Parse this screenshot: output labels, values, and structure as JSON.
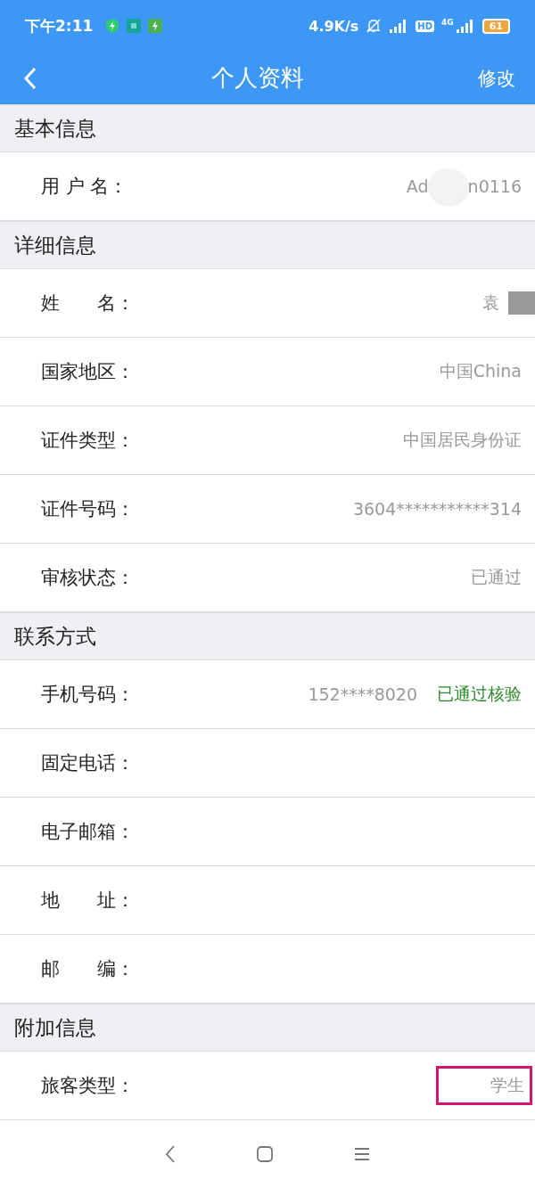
{
  "status_bar": {
    "time": "下午2:11",
    "speed": "4.9K/s",
    "hd": "HD",
    "network": "4G",
    "battery": "61"
  },
  "nav": {
    "title": "个人资料",
    "action": "修改"
  },
  "sections": [
    {
      "title": "基本信息",
      "rows": [
        {
          "label": "用 户 名：",
          "value_parts": [
            "Ad",
            "n0116"
          ],
          "redacted": true
        }
      ]
    },
    {
      "title": "详细信息",
      "rows": [
        {
          "label": "姓　　名：",
          "value_parts": [
            "袁"
          ],
          "redacted": true
        },
        {
          "label": "国家地区：",
          "value_parts": [
            "中国China"
          ]
        },
        {
          "label": "证件类型：",
          "value_parts": [
            "中国居民身份证"
          ]
        },
        {
          "label": "证件号码：",
          "value_parts": [
            "3604***********314"
          ]
        },
        {
          "label": "审核状态：",
          "value_parts": [
            "已通过"
          ]
        }
      ]
    },
    {
      "title": "联系方式",
      "rows": [
        {
          "label": "手机号码：",
          "value_parts": [
            "152****8020"
          ],
          "note": "已通过核验"
        },
        {
          "label": "固定电话："
        },
        {
          "label": "电子邮箱："
        },
        {
          "label": "地　　址："
        },
        {
          "label": "邮　　编："
        }
      ]
    },
    {
      "title": "附加信息",
      "rows": [
        {
          "label": "旅客类型：",
          "value_parts": [
            "学生"
          ],
          "highlighted": true
        }
      ]
    }
  ]
}
